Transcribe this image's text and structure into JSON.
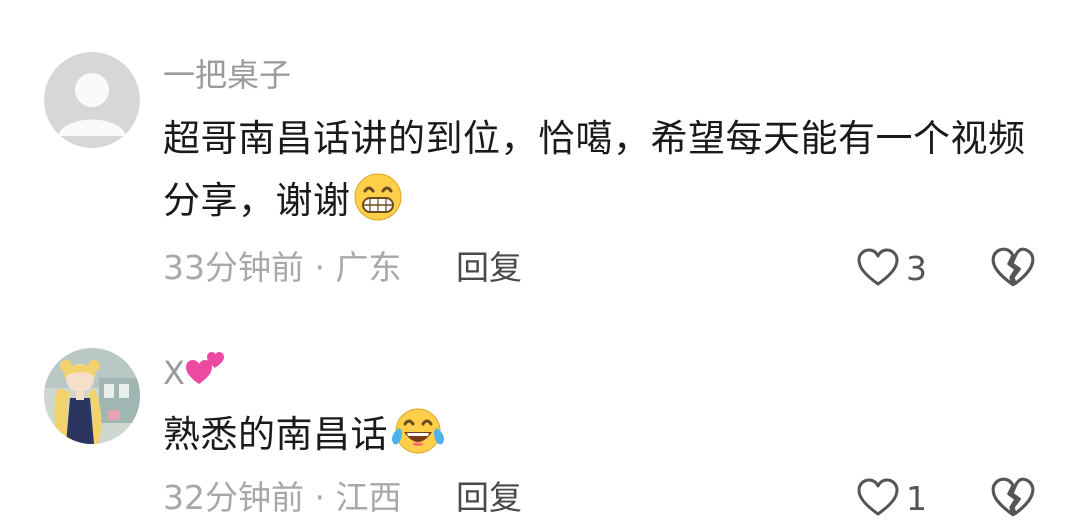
{
  "comments": [
    {
      "username": "一把桌子",
      "text": "超哥南昌话讲的到位，恰噶，希望每天能有一个视频分享，谢谢",
      "emoji": "grin-emoji",
      "time": "33分钟前",
      "location": "广东",
      "meta": "33分钟前 · 广东",
      "reply_label": "回复",
      "like_count": "3"
    },
    {
      "username": "X",
      "username_emoji": "two-hearts-emoji",
      "text": "熟悉的南昌话",
      "emoji": "tears-of-joy-emoji",
      "time": "32分钟前",
      "location": "江西",
      "meta": "32分钟前 · 江西",
      "reply_label": "回复",
      "like_count": "1"
    }
  ],
  "colors": {
    "secondary_text": "#9b9b9b",
    "primary_text": "#1a1a1a",
    "icon": "#555555"
  }
}
